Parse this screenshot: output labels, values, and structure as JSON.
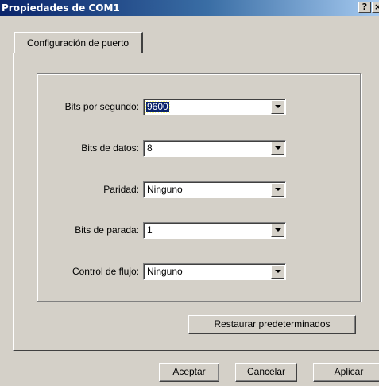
{
  "window": {
    "title": "Propiedades de COM1",
    "help_label": "?",
    "close_label": "×"
  },
  "tabs": [
    {
      "label": "Configuración de puerto",
      "active": true
    }
  ],
  "settings": [
    {
      "label": "Bits por segundo:",
      "value": "9600",
      "selected": true
    },
    {
      "label": "Bits de datos:",
      "value": "8"
    },
    {
      "label": "Paridad:",
      "value": "Ninguno"
    },
    {
      "label": "Bits de parada:",
      "value": "1"
    },
    {
      "label": "Control de flujo:",
      "value": "Ninguno"
    }
  ],
  "buttons": {
    "restore": "Restaurar predeterminados",
    "ok": "Aceptar",
    "cancel": "Cancelar",
    "apply": "Aplicar"
  },
  "colors": {
    "titlebar_start": "#0a246a",
    "titlebar_end": "#a6caf0",
    "face": "#d4d0c8",
    "selection": "#0a246a"
  }
}
